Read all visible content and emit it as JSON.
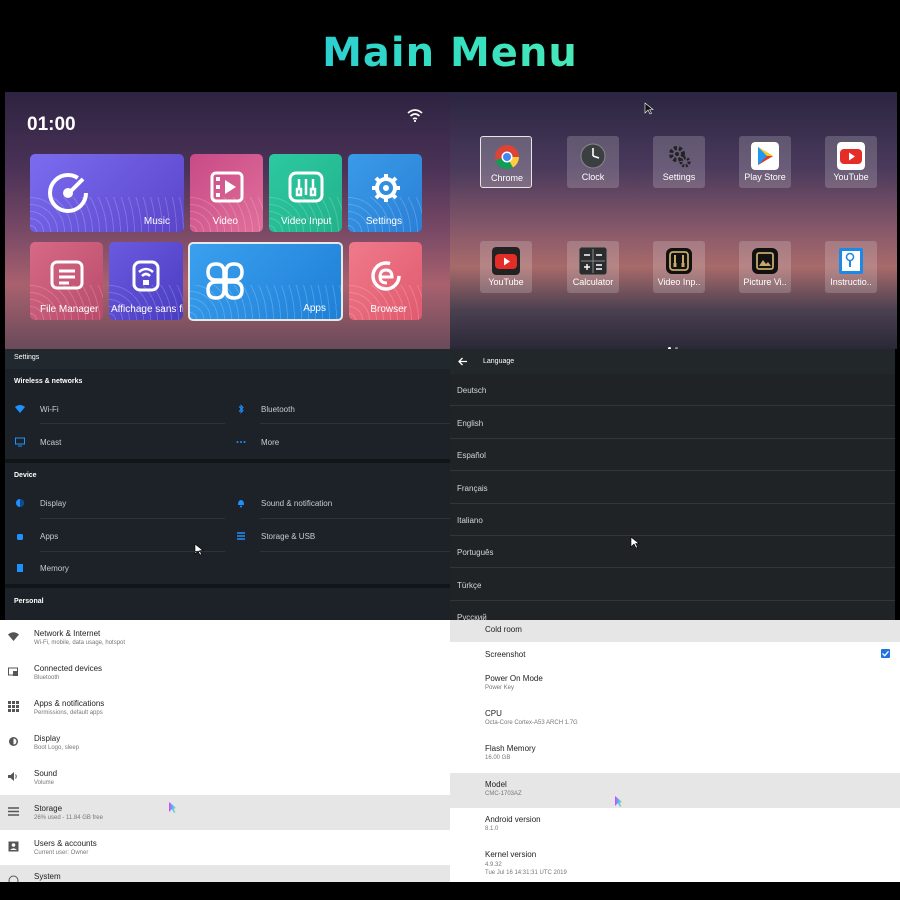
{
  "title": "Main Menu",
  "launcher": {
    "time": "01:00",
    "tiles": {
      "music": "Music",
      "video": "Video",
      "video_input": "Video Input",
      "settings": "Settings",
      "file_manager": "File Manager",
      "affichage": "Affichage sans fil",
      "apps": "Apps",
      "browser": "Browser"
    }
  },
  "app_drawer": {
    "apps": [
      {
        "label": "Chrome",
        "icon": "chrome-icon"
      },
      {
        "label": "Clock",
        "icon": "clock-icon"
      },
      {
        "label": "Settings",
        "icon": "gear-icon"
      },
      {
        "label": "Play Store",
        "icon": "play-store-icon"
      },
      {
        "label": "YouTube",
        "icon": "youtube-icon"
      },
      {
        "label": "YouTube",
        "icon": "youtube-icon"
      },
      {
        "label": "Calculator",
        "icon": "calculator-icon"
      },
      {
        "label": "Video Inp..",
        "icon": "video-input-icon"
      },
      {
        "label": "Picture Vi..",
        "icon": "picture-viewer-icon"
      },
      {
        "label": "Instructio..",
        "icon": "instruction-icon"
      }
    ]
  },
  "dark_settings": {
    "header": "Settings",
    "wireless_header": "Wireless & networks",
    "wifi": "Wi-Fi",
    "bluetooth": "Bluetooth",
    "mcast": "Mcast",
    "more": "More",
    "device_header": "Device",
    "display": "Display",
    "sound": "Sound & notification",
    "apps": "Apps",
    "storage": "Storage & USB",
    "memory": "Memory",
    "personal_header": "Personal"
  },
  "language": {
    "header": "Language",
    "items": [
      "Deutsch",
      "English",
      "Español",
      "Français",
      "Italiano",
      "Português",
      "Türkçe",
      "Русский"
    ]
  },
  "light_settings": {
    "items": [
      {
        "title": "Network & Internet",
        "sub": "Wi-Fi, mobile, data usage, hotspot",
        "icon": "wifi-icon"
      },
      {
        "title": "Connected devices",
        "sub": "Bluetooth",
        "icon": "devices-icon"
      },
      {
        "title": "Apps & notifications",
        "sub": "Permissions, default apps",
        "icon": "apps-grid-icon"
      },
      {
        "title": "Display",
        "sub": "Boot Logo, sleep",
        "icon": "brightness-icon"
      },
      {
        "title": "Sound",
        "sub": "Volume",
        "icon": "volume-icon"
      },
      {
        "title": "Storage",
        "sub": "26% used - 11.84 GB free",
        "icon": "storage-icon"
      },
      {
        "title": "Users & accounts",
        "sub": "Current user: Owner",
        "icon": "account-icon"
      },
      {
        "title": "System",
        "sub": "",
        "icon": "info-icon"
      }
    ]
  },
  "about": {
    "cold_room": "Cold room",
    "screenshot": "Screenshot",
    "power_on_mode": "Power On Mode",
    "power_on_mode_value": "Power Key",
    "cpu": "CPU",
    "cpu_value": "Octa-Core Cortex-A53 ARCH 1.7G",
    "flash": "Flash Memory",
    "flash_value": "16.00 GB",
    "model": "Model",
    "model_value": "CMC-1703AZ",
    "android": "Android version",
    "android_value": "8.1.0",
    "kernel": "Kernel version",
    "kernel_value": "4.9.32",
    "kernel_date": "Tue Jul 16 14:31:31 UTC 2019"
  },
  "colors": {
    "accent": "#1f73e0",
    "title_gradient_start": "#1aa3ff",
    "title_gradient_end": "#7dffa5"
  }
}
